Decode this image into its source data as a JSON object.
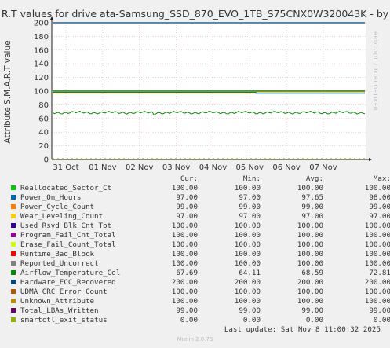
{
  "title": "R.T values for drive ata-Samsung_SSD_870_EVO_1TB_S75CNX0W320043K - by",
  "watermark": "RRDTOOL / TOBI OETIKER",
  "footer": {
    "last_update": "Last update: Sat Nov  8 11:00:32 2025",
    "version": "Munin 2.0.73"
  },
  "legend_headers": {
    "cur": "Cur:",
    "min": "Min:",
    "avg": "Avg:",
    "max": "Max:"
  },
  "chart_data": {
    "type": "line",
    "ylabel": "Attribute S.M.A.R.T value",
    "ylim": [
      0,
      200
    ],
    "yticks": [
      0,
      20,
      40,
      60,
      80,
      100,
      120,
      140,
      160,
      180,
      200
    ],
    "xticks": [
      "31 Oct",
      "01 Nov",
      "02 Nov",
      "03 Nov",
      "04 Nov",
      "05 Nov",
      "06 Nov",
      "07 Nov"
    ],
    "grid": true,
    "series": [
      {
        "name": "Reallocated_Sector_Ct",
        "color": "#00CC00",
        "cur": "100.00",
        "min": "100.00",
        "avg": "100.00",
        "max": "100.00",
        "level": 100
      },
      {
        "name": "Power_On_Hours",
        "color": "#0066B3",
        "cur": "97.00",
        "min": "97.00",
        "avg": "97.65",
        "max": "98.00",
        "level": 97.65
      },
      {
        "name": "Power_Cycle_Count",
        "color": "#FF8000",
        "cur": "99.00",
        "min": "99.00",
        "avg": "99.00",
        "max": "99.00",
        "level": 99
      },
      {
        "name": "Wear_Leveling_Count",
        "color": "#FFCC00",
        "cur": "97.00",
        "min": "97.00",
        "avg": "97.00",
        "max": "97.00",
        "level": 97
      },
      {
        "name": "Used_Rsvd_Blk_Cnt_Tot",
        "color": "#330099",
        "cur": "100.00",
        "min": "100.00",
        "avg": "100.00",
        "max": "100.00",
        "level": 100
      },
      {
        "name": "Program_Fail_Cnt_Total",
        "color": "#990099",
        "cur": "100.00",
        "min": "100.00",
        "avg": "100.00",
        "max": "100.00",
        "level": 100
      },
      {
        "name": "Erase_Fail_Count_Total",
        "color": "#CCFF00",
        "cur": "100.00",
        "min": "100.00",
        "avg": "100.00",
        "max": "100.00",
        "level": 100
      },
      {
        "name": "Runtime_Bad_Block",
        "color": "#FF0000",
        "cur": "100.00",
        "min": "100.00",
        "avg": "100.00",
        "max": "100.00",
        "level": 100
      },
      {
        "name": "Reported_Uncorrect",
        "color": "#808080",
        "cur": "100.00",
        "min": "100.00",
        "avg": "100.00",
        "max": "100.00",
        "level": 100
      },
      {
        "name": "Airflow_Temperature_Cel",
        "color": "#008F00",
        "cur": "67.69",
        "min": "64.11",
        "avg": "68.59",
        "max": "72.81",
        "level": 68.59
      },
      {
        "name": "Hardware_ECC_Recovered",
        "color": "#00487D",
        "cur": "200.00",
        "min": "200.00",
        "avg": "200.00",
        "max": "200.00",
        "level": 200
      },
      {
        "name": "UDMA_CRC_Error_Count",
        "color": "#B35A00",
        "cur": "100.00",
        "min": "100.00",
        "avg": "100.00",
        "max": "100.00",
        "level": 100
      },
      {
        "name": "Unknown_Attribute",
        "color": "#B38F00",
        "cur": "100.00",
        "min": "100.00",
        "avg": "100.00",
        "max": "100.00",
        "level": 100
      },
      {
        "name": "Total_LBAs_Written",
        "color": "#6B006B",
        "cur": "99.00",
        "min": "99.00",
        "avg": "99.00",
        "max": "99.00",
        "level": 99
      },
      {
        "name": "smartctl_exit_status",
        "color": "#8FB300",
        "cur": "0.00",
        "min": "0.00",
        "avg": "0.00",
        "max": "0.00",
        "level": 0
      }
    ]
  }
}
